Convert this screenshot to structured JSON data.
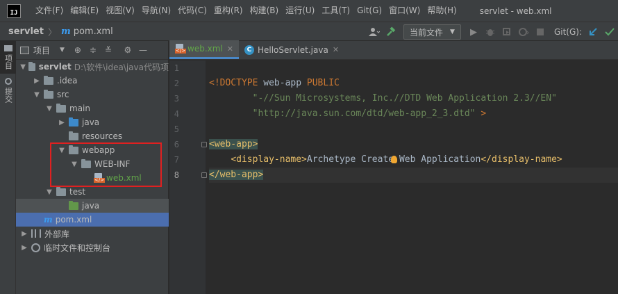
{
  "menubar": {
    "logo": "IJ",
    "items": [
      "文件(F)",
      "编辑(E)",
      "视图(V)",
      "导航(N)",
      "代码(C)",
      "重构(R)",
      "构建(B)",
      "运行(U)",
      "工具(T)",
      "Git(G)",
      "窗口(W)",
      "帮助(H)"
    ],
    "window_title": "servlet - web.xml"
  },
  "navbar": {
    "project": "servlet",
    "file_icon": "m",
    "file": "pom.xml",
    "run_config": "当前文件",
    "git_label": "Git(G):"
  },
  "left_strip": {
    "project_tab": "项目",
    "commit_tab": "提交"
  },
  "project_panel": {
    "title": "项目",
    "tree": {
      "root_name": "servlet",
      "root_path": "D:\\软件\\idea\\java代码项",
      "idea": ".idea",
      "src": "src",
      "main": "main",
      "java_main": "java",
      "resources": "resources",
      "webapp": "webapp",
      "webinf": "WEB-INF",
      "webxml": "web.xml",
      "test": "test",
      "java_test": "java",
      "pom_icon": "m",
      "pom": "pom.xml",
      "external_libs": "外部库",
      "scratches": "临时文件和控制台"
    }
  },
  "editor": {
    "tabs": [
      {
        "label": "web.xml",
        "icon": "xml-file-icon",
        "active": true
      },
      {
        "icon_letter": "C",
        "label": "HelloServlet.java",
        "active": false
      }
    ],
    "line_numbers": [
      "1",
      "2",
      "3",
      "4",
      "5",
      "6",
      "7",
      "8"
    ],
    "code": {
      "l2_a": "<!DOCTYPE",
      "l2_b": " web-app ",
      "l2_c": "PUBLIC",
      "l3": "        \"-//Sun Microsystems, Inc.//DTD Web Application 2.3//EN\"",
      "l4_a": "        \"http://java.sun.com/dtd/web-app_2_3.dtd\"",
      "l4_b": " >",
      "l6": "<web-app>",
      "l7_indent": "    ",
      "l7_open": "<display-name>",
      "l7_text_a": "Archetype Create",
      "l7_text_b": " Web Application",
      "l7_close": "</display-name>",
      "l8": "</web-app>"
    }
  },
  "colors": {
    "accent_tab": "#4a88c7",
    "selection": "#4b6eaf",
    "highlight_box": "#e02020",
    "tag_yellow": "#e8bf6a",
    "string_green": "#6a8759",
    "keyword_orange": "#cc7832"
  }
}
